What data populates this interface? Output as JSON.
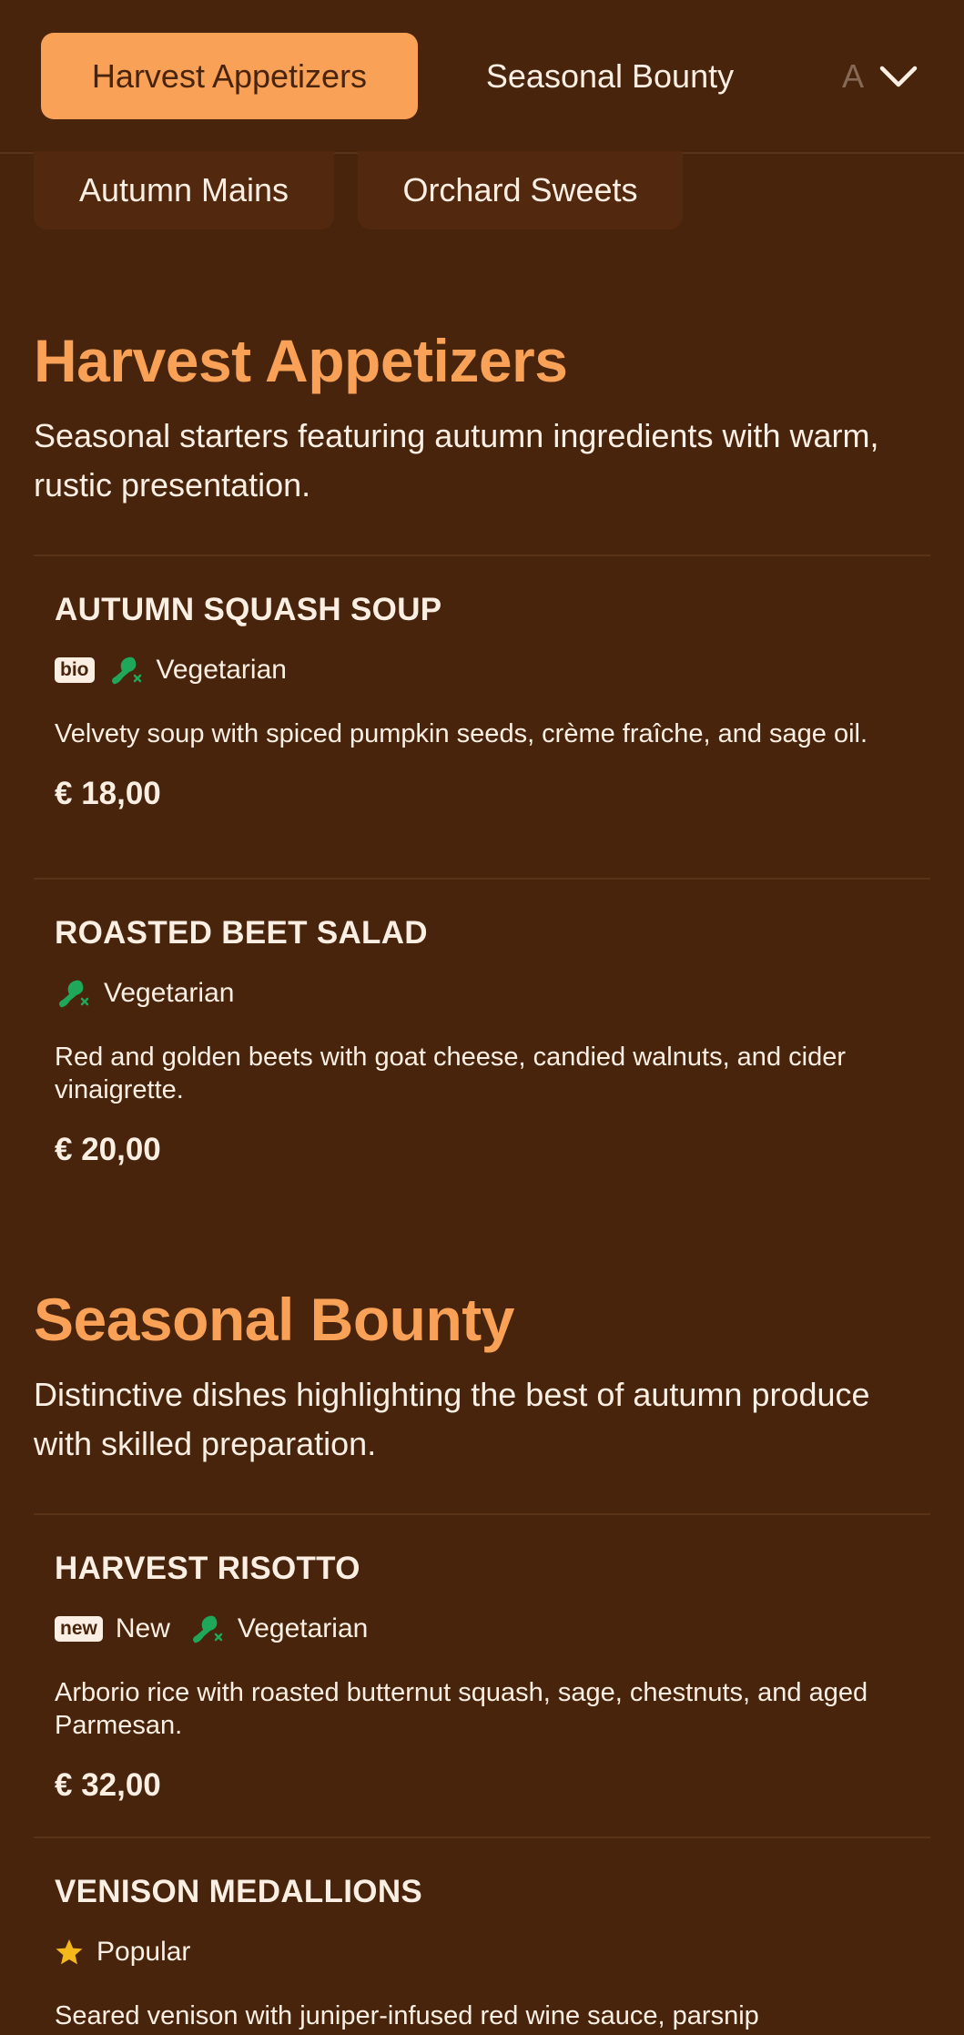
{
  "nav": {
    "tabs": [
      {
        "label": "Harvest Appetizers",
        "active": true
      },
      {
        "label": "Seasonal Bounty",
        "active": false
      },
      {
        "label": "A",
        "active": false
      }
    ],
    "more_tabs": [
      {
        "label": "Autumn Mains"
      },
      {
        "label": "Orchard Sweets"
      }
    ],
    "expand_icon": "chevron-down-icon"
  },
  "sections": [
    {
      "title": "Harvest Appetizers",
      "description": "Seasonal starters featuring autumn ingredients with warm, rustic presentation.",
      "items": [
        {
          "name": "AUTUMN SQUASH SOUP",
          "badge": "bio",
          "veg_label": "Vegetarian",
          "description": "Velvety soup with spiced pumpkin seeds, crème fraîche, and sage oil.",
          "price": "€ 18,00"
        },
        {
          "name": "ROASTED BEET SALAD",
          "veg_label": "Vegetarian",
          "description": "Red and golden beets with goat cheese, candied walnuts, and cider vinaigrette.",
          "price": "€ 20,00"
        }
      ]
    },
    {
      "title": "Seasonal Bounty",
      "description": "Distinctive dishes highlighting the best of autumn produce with skilled preparation.",
      "items": [
        {
          "name": "HARVEST RISOTTO",
          "badge": "new",
          "badge_label": "New",
          "veg_label": "Vegetarian",
          "description": "Arborio rice with roasted butternut squash, sage, chestnuts, and aged Parmesan.",
          "price": "€ 32,00"
        },
        {
          "name": "VENISON MEDALLIONS",
          "popular_label": "Popular",
          "description": "Seared venison with juniper-infused red wine sauce, parsnip"
        }
      ]
    }
  ],
  "colors": {
    "background": "#48240c",
    "accent": "#f9a257",
    "text": "#fbefe3",
    "veg_green": "#1fa85a",
    "star": "#f5b81c"
  }
}
